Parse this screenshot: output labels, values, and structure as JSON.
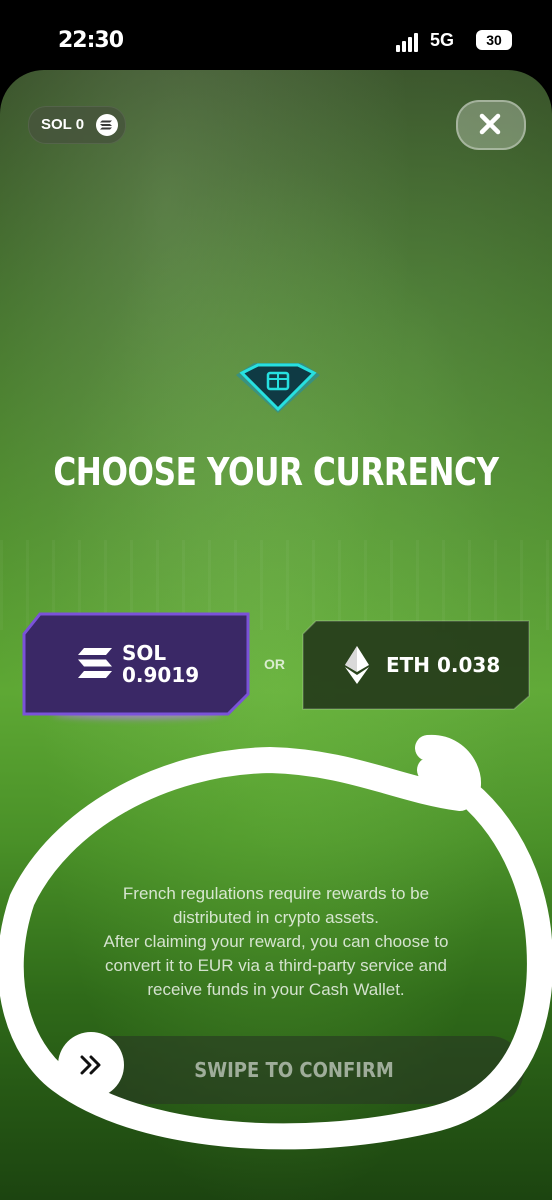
{
  "status_bar": {
    "time": "22:30",
    "network": "5G",
    "battery": "30"
  },
  "header": {
    "sol_balance": "SOL 0",
    "close_icon": "close-icon"
  },
  "main": {
    "title": "CHOOSE YOUR CURRENCY",
    "icon": "gem-icon",
    "options": {
      "sol": {
        "symbol": "SOL",
        "amount": "0.9019",
        "icon": "solana-icon",
        "selected": true
      },
      "or_label": "OR",
      "eth": {
        "label": "ETH 0.038",
        "icon": "ethereum-icon",
        "selected": false
      }
    },
    "disclaimer": [
      "French regulations require rewards to be",
      "distributed in crypto assets.",
      "After claiming your reward, you can choose to",
      "convert it to EUR via a third-party service and",
      "receive funds in your Cash Wallet."
    ],
    "swipe": {
      "label": "SWIPE TO CONFIRM",
      "handle_icon": "double-chevron-right-icon"
    }
  },
  "colors": {
    "sol_selected_bg": "#3a2866",
    "sol_selected_border": "#7a52d9",
    "eth_bg": "#23391a",
    "accent_gem": "#27e0e0"
  }
}
